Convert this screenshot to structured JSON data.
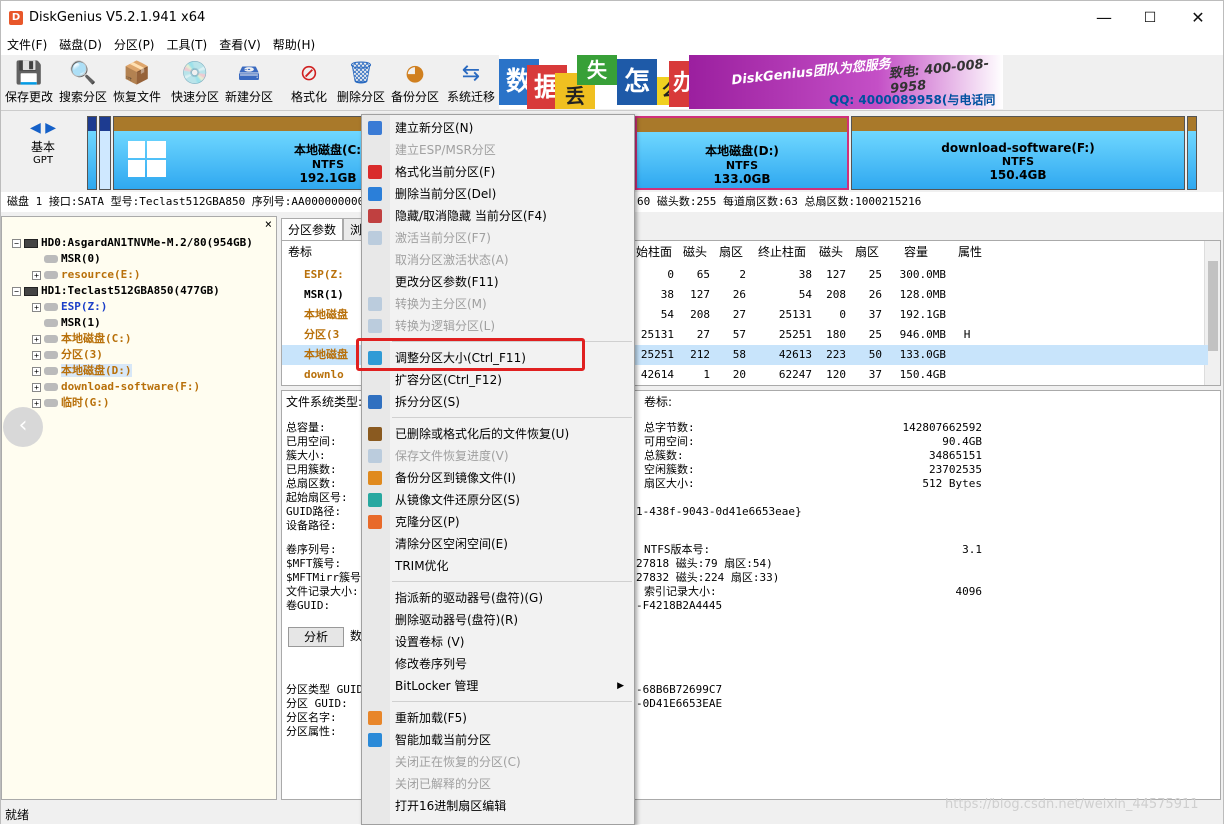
{
  "window": {
    "title": "DiskGenius V5.2.1.941 x64",
    "app_icon": "D",
    "minimize": "—",
    "maximize": "☐",
    "close": "✕"
  },
  "menu": [
    "文件(F)",
    "磁盘(D)",
    "分区(P)",
    "工具(T)",
    "查看(V)",
    "帮助(H)"
  ],
  "toolbar": [
    {
      "label": "保存更改",
      "icon": "save-icon",
      "glyph": "💾"
    },
    {
      "label": "搜索分区",
      "icon": "search-icon",
      "glyph": "🔍"
    },
    {
      "label": "恢复文件",
      "icon": "recover-icon",
      "glyph": "📦"
    },
    {
      "label": "快速分区",
      "icon": "quick-partition-icon",
      "glyph": "💿"
    },
    {
      "label": "新建分区",
      "icon": "new-partition-icon",
      "glyph": "🖴"
    },
    {
      "label": "格式化",
      "icon": "format-icon",
      "glyph": "⊘"
    },
    {
      "label": "删除分区",
      "icon": "delete-icon",
      "glyph": "🗑"
    },
    {
      "label": "备份分区",
      "icon": "backup-icon",
      "glyph": "◕"
    },
    {
      "label": "系统迁移",
      "icon": "migrate-icon",
      "glyph": "⇆"
    }
  ],
  "banner": {
    "chars": [
      "数",
      "据",
      "丢",
      "失",
      "怎",
      "么",
      "办"
    ],
    "slogan": "DiskGenius团队为您服务",
    "phone": "致电: 400-008-9958",
    "qq": "QQ: 4000089958(与电话同号)"
  },
  "diskmap": {
    "type1": "基本",
    "type2": "GPT",
    "partitions": [
      {
        "name": "本地磁盘(C:)",
        "fs": "NTFS",
        "size": "192.1GB"
      },
      {
        "name": "本地磁盘(D:)",
        "fs": "NTFS",
        "size": "133.0GB"
      },
      {
        "name": "download-software(F:)",
        "fs": "NTFS",
        "size": "150.4GB"
      }
    ]
  },
  "diskinfo": "磁盘 1 接口:SATA  型号:Teclast512GBA850  序列号:AA000000000",
  "diskinfo_right": "60  磁头数:255  每道扇区数:63  总扇区数:1000215216",
  "tree": [
    {
      "label": "HD0:AsgardAN1TNVMe-M.2/80(954GB)",
      "kind": "disk",
      "color": ""
    },
    {
      "label": "MSR(0)",
      "kind": "part",
      "color": ""
    },
    {
      "label": "resource(E:)",
      "kind": "part",
      "color": "orange"
    },
    {
      "label": "HD1:Teclast512GBA850(477GB)",
      "kind": "disk",
      "color": ""
    },
    {
      "label": "ESP(Z:)",
      "kind": "part",
      "color": "blue"
    },
    {
      "label": "MSR(1)",
      "kind": "part",
      "color": ""
    },
    {
      "label": "本地磁盘(C:)",
      "kind": "part",
      "color": "orange"
    },
    {
      "label": "分区(3)",
      "kind": "part",
      "color": "orange"
    },
    {
      "label": "本地磁盘(D:)",
      "kind": "part",
      "color": "orange"
    },
    {
      "label": "download-software(F:)",
      "kind": "part",
      "color": "orange"
    },
    {
      "label": "临时(G:)",
      "kind": "part",
      "color": "orange"
    }
  ],
  "tabs": [
    "分区参数",
    "浏"
  ],
  "table": {
    "headers": [
      "卷标",
      "始柱面",
      "磁头",
      "扇区",
      "终止柱面",
      "磁头",
      "扇区",
      "容量",
      "属性"
    ],
    "rows": [
      {
        "name": "ESP(Z:",
        "c": [
          "0",
          "65",
          "2",
          "38",
          "127",
          "25",
          "300.0MB",
          ""
        ]
      },
      {
        "name": "MSR(1)",
        "c": [
          "38",
          "127",
          "26",
          "54",
          "208",
          "26",
          "128.0MB",
          ""
        ]
      },
      {
        "name": "本地磁盘",
        "c": [
          "54",
          "208",
          "27",
          "25131",
          "0",
          "37",
          "192.1GB",
          ""
        ]
      },
      {
        "name": "分区(3",
        "c": [
          "25131",
          "27",
          "57",
          "25251",
          "180",
          "25",
          "946.0MB",
          "H"
        ]
      },
      {
        "name": "本地磁盘",
        "c": [
          "25251",
          "212",
          "58",
          "42613",
          "223",
          "50",
          "133.0GB",
          ""
        ]
      },
      {
        "name": "downlo",
        "c": [
          "42614",
          "1",
          "20",
          "62247",
          "120",
          "37",
          "150.4GB",
          ""
        ]
      }
    ]
  },
  "details": {
    "fs_label": "文件系统类型:",
    "vol_label": "卷标:",
    "left1": [
      "总容量:",
      "已用空间:",
      "簇大小:",
      "已用簇数:",
      "总扇区数:",
      "起始扇区号:",
      "GUID路径:",
      "设备路径:"
    ],
    "right1_labels": [
      "总字节数:",
      "可用空间:",
      "总簇数:",
      "空闲簇数:",
      "扇区大小:"
    ],
    "right1_values": [
      "142807662592",
      "90.4GB",
      "34865151",
      "23702535",
      "512 Bytes"
    ],
    "guid_tail": "1-438f-9043-0d41e6653eae}",
    "left2": [
      "卷序列号:",
      "$MFT簇号:",
      "$MFTMirr簇号:",
      "文件记录大小:",
      "卷GUID:"
    ],
    "ntfs_label": "NTFS版本号:",
    "ntfs_value": "3.1",
    "mft_tail": "27818 磁头:79 扇区:54)",
    "mftm_tail": "27832 磁头:224 扇区:33)",
    "index_label": "索引记录大小:",
    "index_value": "4096",
    "volguid_tail": "-F4218B2A4445",
    "analyze": "分析",
    "data_btn": "数",
    "left3": [
      "分区类型 GUID:",
      "分区 GUID:",
      "分区名字:",
      "分区属性:"
    ],
    "ptype_tail": "-68B6B72699C7",
    "pguid_tail": "-0D41E6653EAE"
  },
  "context_menu": [
    {
      "label": "建立新分区(N)",
      "disabled": false,
      "icon": "#3a7bd5",
      "sep_after": false
    },
    {
      "label": "建立ESP/MSR分区",
      "disabled": true,
      "icon": "",
      "sep_after": false
    },
    {
      "label": "格式化当前分区(F)",
      "disabled": false,
      "icon": "#d92b2b",
      "sep_after": false
    },
    {
      "label": "删除当前分区(Del)",
      "disabled": false,
      "icon": "#2b7fd9",
      "sep_after": false
    },
    {
      "label": "隐藏/取消隐藏 当前分区(F4)",
      "disabled": false,
      "icon": "#c04040",
      "sep_after": false
    },
    {
      "label": "激活当前分区(F7)",
      "disabled": true,
      "icon": "#bcd",
      "sep_after": false
    },
    {
      "label": "取消分区激活状态(A)",
      "disabled": true,
      "icon": "",
      "sep_after": false
    },
    {
      "label": "更改分区参数(F11)",
      "disabled": false,
      "icon": "",
      "sep_after": false
    },
    {
      "label": "转换为主分区(M)",
      "disabled": true,
      "icon": "#bcd",
      "sep_after": false
    },
    {
      "label": "转换为逻辑分区(L)",
      "disabled": true,
      "icon": "#bcd",
      "sep_after": true
    },
    {
      "label": "调整分区大小(Ctrl_F11)",
      "disabled": false,
      "icon": "#2f9bd6",
      "sep_after": false
    },
    {
      "label": "扩容分区(Ctrl_F12)",
      "disabled": false,
      "icon": "",
      "sep_after": false
    },
    {
      "label": "拆分分区(S)",
      "disabled": false,
      "icon": "#3070c0",
      "sep_after": true
    },
    {
      "label": "已删除或格式化后的文件恢复(U)",
      "disabled": false,
      "icon": "#8a5a20",
      "sep_after": false
    },
    {
      "label": "保存文件恢复进度(V)",
      "disabled": true,
      "icon": "#bcd",
      "sep_after": false
    },
    {
      "label": "备份分区到镜像文件(I)",
      "disabled": false,
      "icon": "#e08a1e",
      "sep_after": false
    },
    {
      "label": "从镜像文件还原分区(S)",
      "disabled": false,
      "icon": "#28a8a0",
      "sep_after": false
    },
    {
      "label": "克隆分区(P)",
      "disabled": false,
      "icon": "#e86a2a",
      "sep_after": false
    },
    {
      "label": "清除分区空闲空间(E)",
      "disabled": false,
      "icon": "",
      "sep_after": false
    },
    {
      "label": "TRIM优化",
      "disabled": false,
      "icon": "",
      "sep_after": true
    },
    {
      "label": "指派新的驱动器号(盘符)(G)",
      "disabled": false,
      "icon": "",
      "sep_after": false
    },
    {
      "label": "删除驱动器号(盘符)(R)",
      "disabled": false,
      "icon": "",
      "sep_after": false
    },
    {
      "label": "设置卷标 (V)",
      "disabled": false,
      "icon": "",
      "sep_after": false
    },
    {
      "label": "修改卷序列号",
      "disabled": false,
      "icon": "",
      "sep_after": false
    },
    {
      "label": "BitLocker 管理",
      "disabled": false,
      "icon": "",
      "sep_after": true,
      "submenu": true
    },
    {
      "label": "重新加载(F5)",
      "disabled": false,
      "icon": "#e8862a",
      "sep_after": false
    },
    {
      "label": "智能加载当前分区",
      "disabled": false,
      "icon": "#2a8ad8",
      "sep_after": false
    },
    {
      "label": "关闭正在恢复的分区(C)",
      "disabled": true,
      "icon": "",
      "sep_after": false
    },
    {
      "label": "关闭已解释的分区",
      "disabled": true,
      "icon": "",
      "sep_after": false
    },
    {
      "label": "打开16进制扇区编辑",
      "disabled": false,
      "icon": "",
      "sep_after": false
    }
  ],
  "status": "就绪",
  "watermark": "https://blog.csdn.net/weixin_44575911",
  "colors": {
    "partition_header": "#a9792a",
    "partition_fill": "#2fa8f0",
    "selected_row": "#c8e4fb",
    "highlight": "#e02020",
    "active_partition_border": "#d0307a"
  }
}
